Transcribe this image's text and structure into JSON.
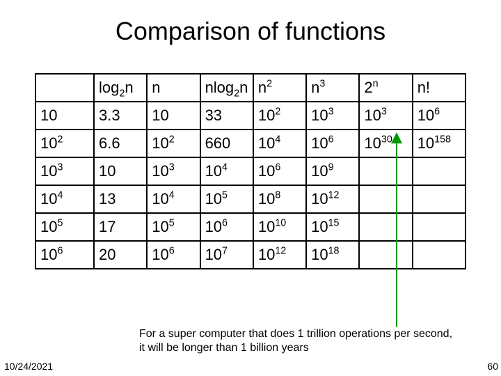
{
  "title": "Comparison of functions",
  "headers": {
    "blank": "",
    "c1": "log|2|n",
    "c2": "n",
    "c3": "nlog|2|n",
    "c4": "n^2",
    "c5": "n^3",
    "c6": "2^n",
    "c7": "n!"
  },
  "rows": [
    {
      "hdr": "10",
      "c1": "3.3",
      "c2": "10",
      "c3": "33",
      "c4": "10^2",
      "c5": "10^3",
      "c6": "10^3",
      "c7": "10^6"
    },
    {
      "hdr": "10^2",
      "c1": "6.6",
      "c2": "10^2",
      "c3": "660",
      "c4": "10^4",
      "c5": "10^6",
      "c6": "10^30",
      "c7": "10^158"
    },
    {
      "hdr": "10^3",
      "c1": "10",
      "c2": "10^3",
      "c3": "10^4",
      "c4": "10^6",
      "c5": "10^9",
      "c6": "",
      "c7": ""
    },
    {
      "hdr": "10^4",
      "c1": "13",
      "c2": "10^4",
      "c3": "10^5",
      "c4": "10^8",
      "c5": "10^12",
      "c6": "",
      "c7": ""
    },
    {
      "hdr": "10^5",
      "c1": "17",
      "c2": "10^5",
      "c3": "10^6",
      "c4": "10^10",
      "c5": "10^15",
      "c6": "",
      "c7": ""
    },
    {
      "hdr": "10^6",
      "c1": "20",
      "c2": "10^6",
      "c3": "10^7",
      "c4": "10^12",
      "c5": "10^18",
      "c6": "",
      "c7": ""
    }
  ],
  "caption": "For a super computer that does 1 trillion operations per second, it will be longer than 1 billion years",
  "footer": {
    "date": "10/24/2021",
    "page": "60"
  },
  "arrow_color": "#009900"
}
